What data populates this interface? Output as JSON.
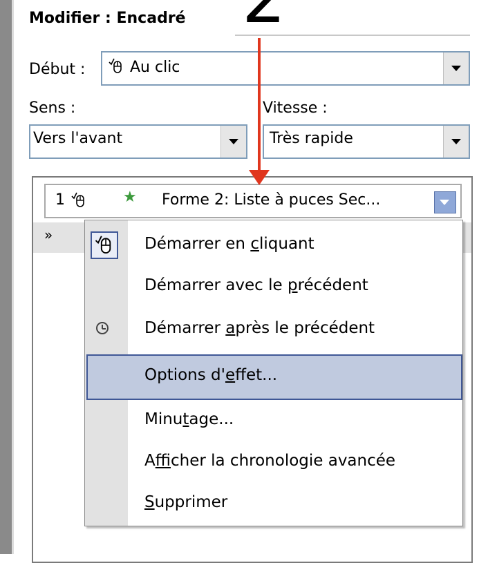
{
  "annotation": {
    "step_number": "2",
    "arrow_color": "#e0361e"
  },
  "panel": {
    "title": "Modifier : Encadré",
    "start": {
      "label": "Début :",
      "value": "Au clic",
      "icon": "mouse-click-icon"
    },
    "direction": {
      "label": "Sens :",
      "value": "Vers l'avant"
    },
    "speed": {
      "label": "Vitesse :",
      "value": "Très rapide"
    }
  },
  "effect_list": {
    "items": [
      {
        "order": "1",
        "trigger_icon": "mouse-click-icon",
        "effect_icon": "star-icon",
        "name": "Forme 2: Liste à puces Sec..."
      }
    ],
    "timeline_icon": "double-chevron-down-icon"
  },
  "context_menu": {
    "items": [
      {
        "pre": "Démarrer en ",
        "key": "c",
        "post": "liquant",
        "icon": "mouse-click-icon",
        "checked": true
      },
      {
        "pre": "Démarrer avec le ",
        "key": "p",
        "post": "récédent",
        "icon": ""
      },
      {
        "pre": "Démarrer ",
        "key": "a",
        "post": "près le précédent",
        "icon": "clock-icon"
      },
      {
        "pre": "Options d'",
        "key": "e",
        "post": "ffet...",
        "icon": "",
        "highlighted": true
      },
      {
        "pre": "Minu",
        "key": "t",
        "post": "age...",
        "icon": ""
      },
      {
        "pre": "A",
        "key": "f",
        "post": "ficher la chronologie avancée",
        "icon": ""
      },
      {
        "pre": "",
        "key": "S",
        "post": "upprimer",
        "icon": ""
      }
    ],
    "highlight_color": "#c0cadf"
  }
}
